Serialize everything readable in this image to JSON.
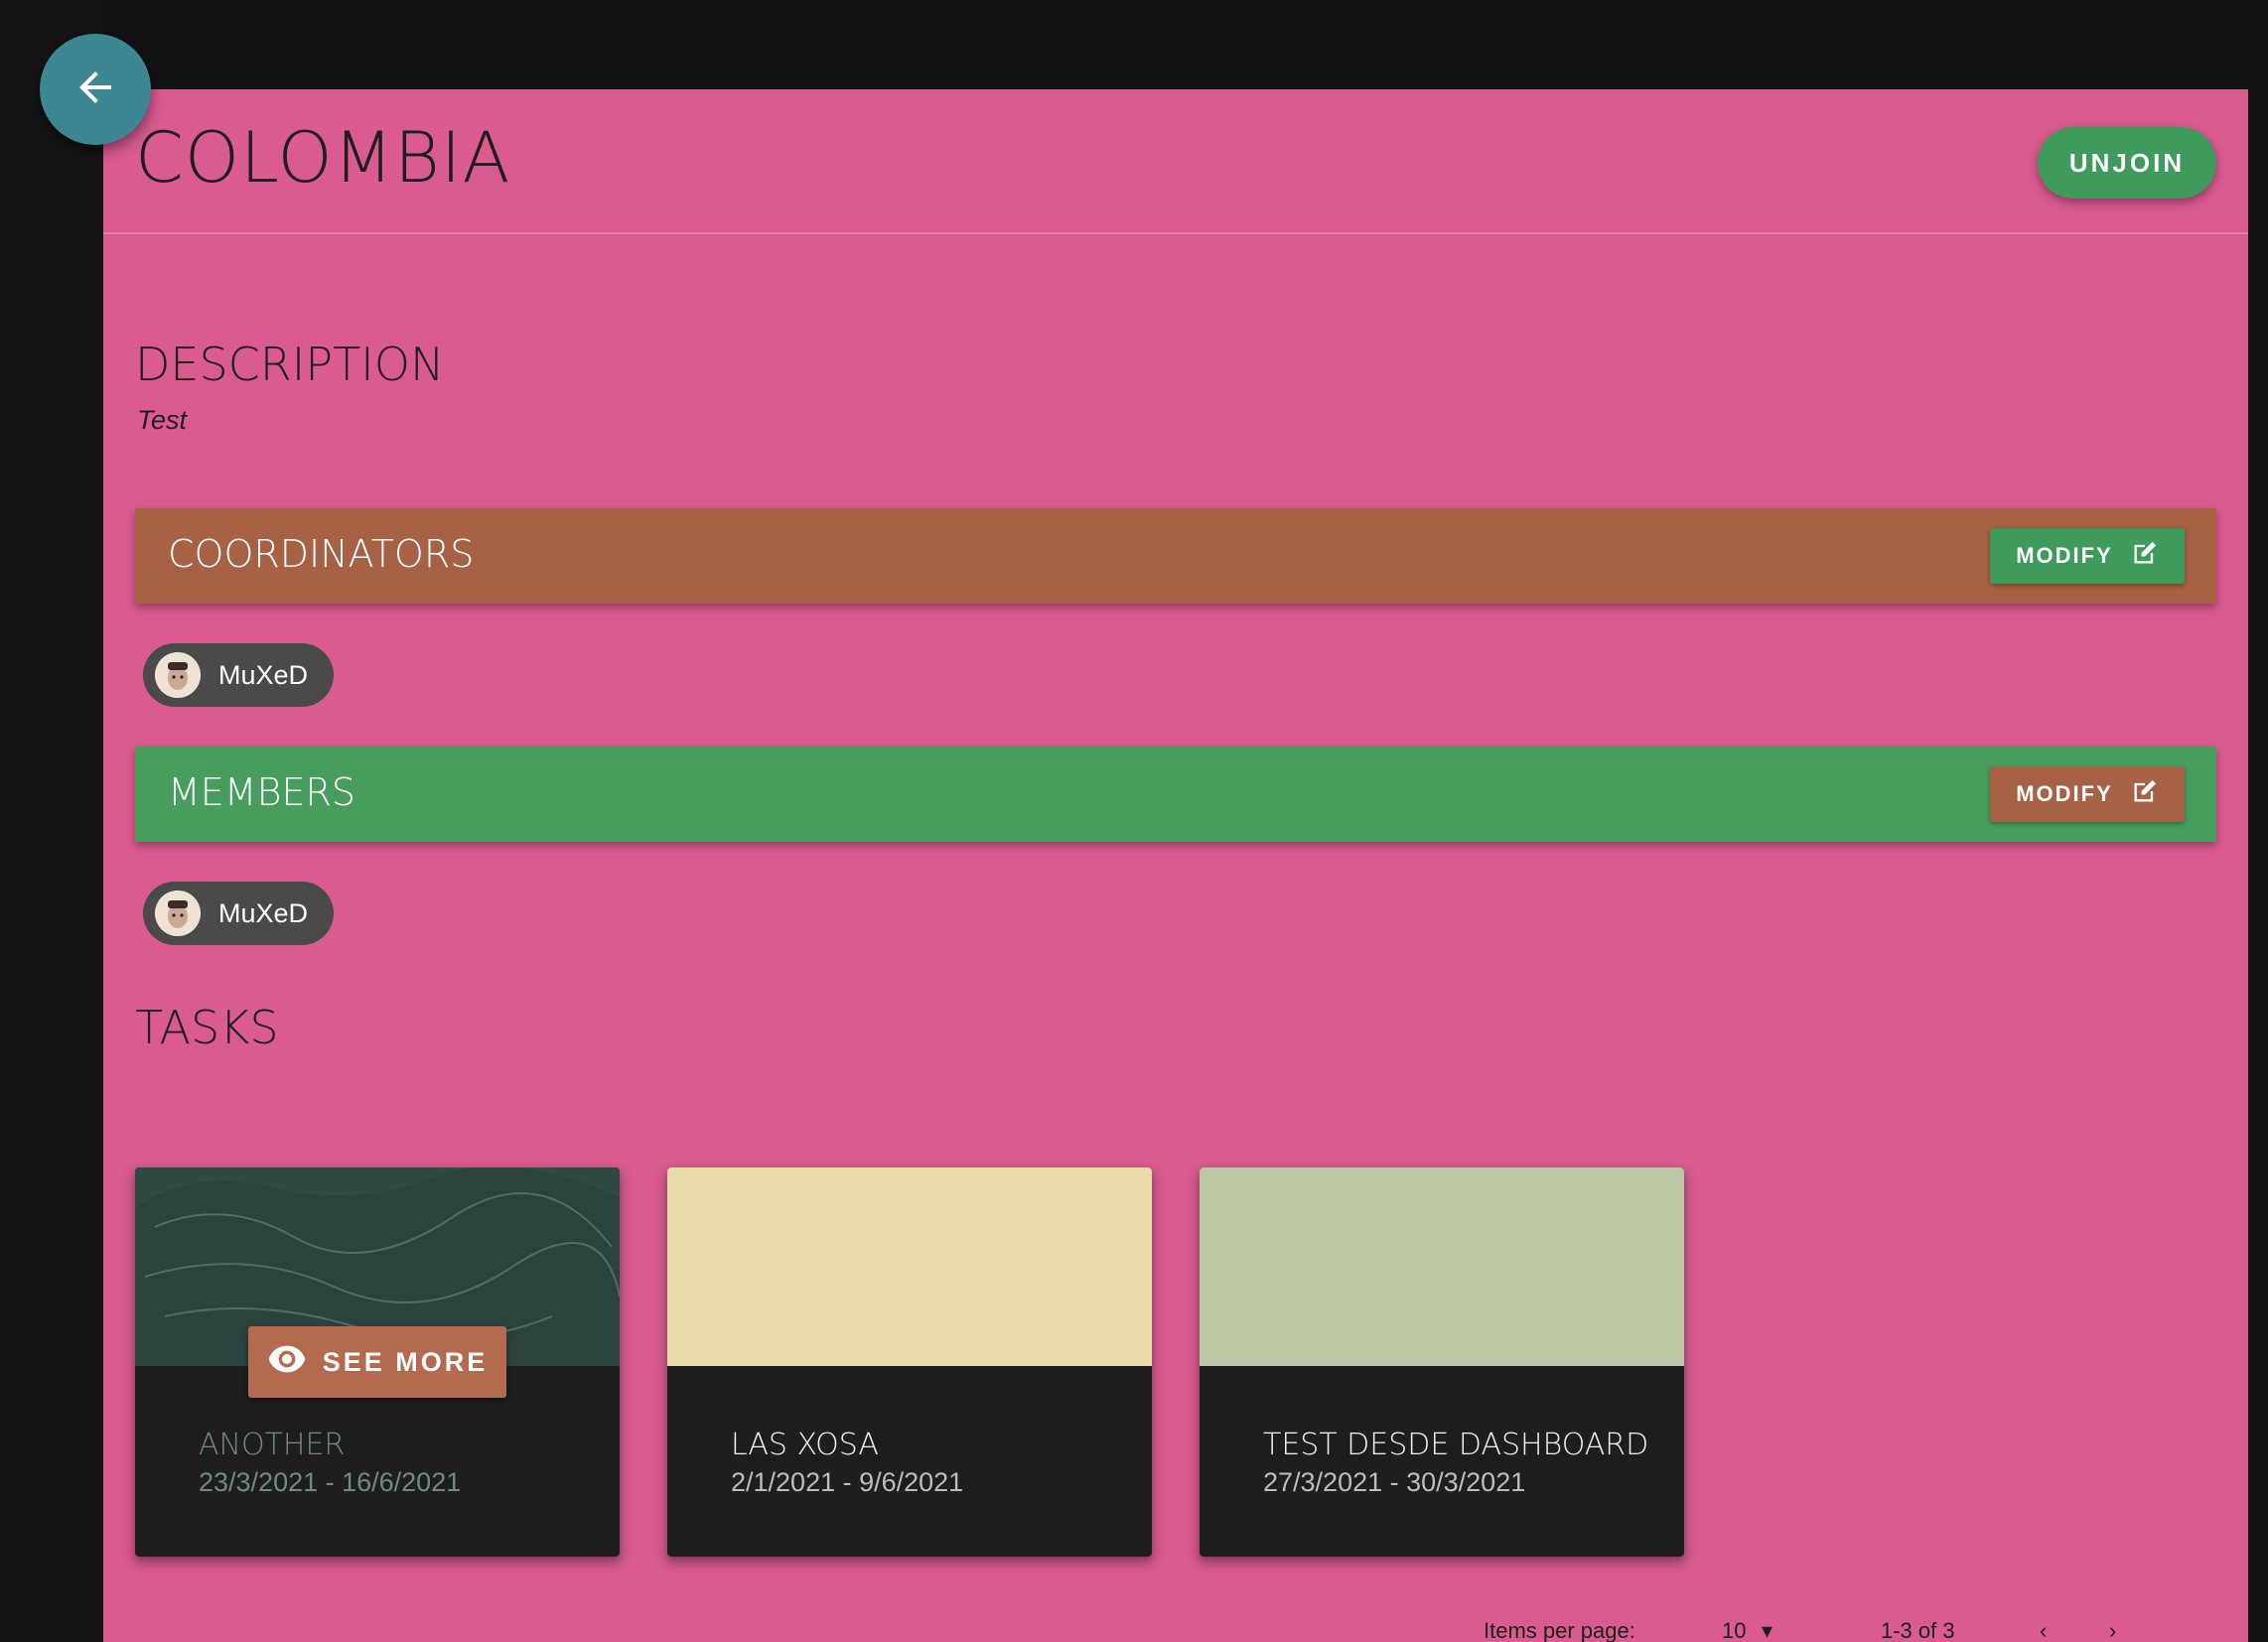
{
  "group": {
    "title": "COLOMBIA",
    "unjoin_label": "UNJOIN"
  },
  "description": {
    "heading": "DESCRIPTION",
    "text": "Test"
  },
  "coordinators": {
    "heading": "COORDINATORS",
    "modify_label": "MODIFY",
    "users": [
      {
        "name": "MuXeD"
      }
    ]
  },
  "members": {
    "heading": "MEMBERS",
    "modify_label": "MODIFY",
    "users": [
      {
        "name": "MuXeD"
      }
    ]
  },
  "tasks": {
    "heading": "TASKS",
    "see_more_label": "SEE MORE",
    "items": [
      {
        "title": "ANOTHER",
        "dates": "23/3/2021 - 16/6/2021",
        "cover_color": "#2f4a43"
      },
      {
        "title": "LAS XOSA",
        "dates": "2/1/2021 - 9/6/2021",
        "cover_color": "#e8daa9"
      },
      {
        "title": "TEST DESDE DASHBOARD",
        "dates": "27/3/2021 - 30/3/2021",
        "cover_color": "#bdc9a6"
      }
    ]
  },
  "pagination": {
    "items_per_page_label": "Items per page:",
    "items_per_page_value": "10",
    "range_label": "1-3 of 3"
  },
  "colors": {
    "page_background": "#d95b90",
    "coordinators_bar": "#a76145",
    "members_bar": "#479d5e",
    "unjoin_button": "#3f9b5b",
    "back_button": "#3c8793"
  },
  "icons": {
    "back": "arrow-left-icon",
    "modify": "edit-icon",
    "see_more": "eye-icon"
  }
}
